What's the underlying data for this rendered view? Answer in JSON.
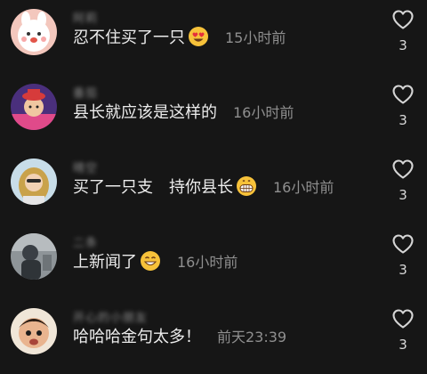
{
  "comments": [
    {
      "username": "阿莉",
      "text": "忍不住买了一只",
      "emoji": "heart-eyes-emoji",
      "time": "15小时前",
      "likes": "3"
    },
    {
      "username": "番茄",
      "text": "县长就应该是这样的",
      "emoji": "",
      "time": "16小时前",
      "likes": "3"
    },
    {
      "username": "晴空",
      "text": "买了一只支　持你县长",
      "emoji": "grinning-emoji",
      "time": "16小时前",
      "likes": "3"
    },
    {
      "username": "二条",
      "text": "上新闻了",
      "emoji": "smiling-emoji",
      "time": "16小时前",
      "likes": "3"
    },
    {
      "username": "开心的小朋友",
      "text": "哈哈哈金句太多！",
      "emoji": "",
      "time": "前天23:39",
      "likes": "3"
    }
  ],
  "colors": {
    "background": "#161616",
    "text": "#ececec",
    "meta": "#8f8f8f"
  }
}
